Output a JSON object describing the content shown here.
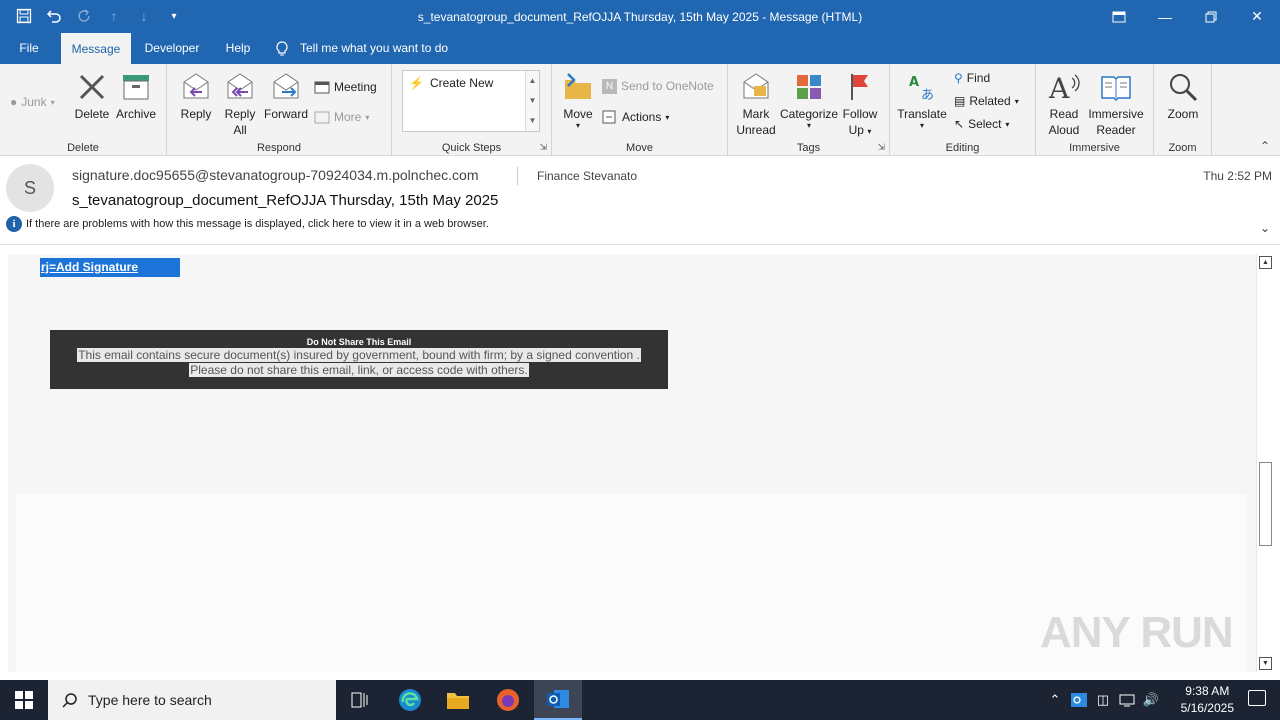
{
  "window": {
    "title": "s_tevanatogroup_document_RefOJJA Thursday, 15th May 2025  -  Message (HTML)"
  },
  "menu": {
    "tabs": [
      "File",
      "Message",
      "Developer",
      "Help"
    ],
    "tellme": "Tell me what you want to do"
  },
  "ribbon": {
    "junk": "Junk",
    "delete": "Delete",
    "archive": "Archive",
    "group_delete": "Delete",
    "reply": "Reply",
    "reply_all_1": "Reply",
    "reply_all_2": "All",
    "forward": "Forward",
    "meeting": "Meeting",
    "more": "More",
    "group_respond": "Respond",
    "create_new": "Create New",
    "group_quicksteps": "Quick Steps",
    "move": "Move",
    "send_onenote": "Send to OneNote",
    "actions": "Actions",
    "group_move": "Move",
    "mark_unread_1": "Mark",
    "mark_unread_2": "Unread",
    "categorize": "Categorize",
    "followup_1": "Follow",
    "followup_2": "Up",
    "group_tags": "Tags",
    "translate": "Translate",
    "find": "Find",
    "related": "Related",
    "select": "Select",
    "group_editing": "Editing",
    "read_aloud_1": "Read",
    "read_aloud_2": "Aloud",
    "immersive_1": "Immersive",
    "immersive_2": "Reader",
    "group_immersive": "Immersive",
    "zoom": "Zoom",
    "group_zoom": "Zoom"
  },
  "message": {
    "avatar_letter": "S",
    "sender": "signature.doc95655@stevanatogroup-70924034.m.polnchec.com",
    "to": "Finance Stevanato",
    "time": "Thu 2:52 PM",
    "subject": "s_tevanatogroup_document_RefOJJA Thursday, 15th May 2025",
    "info": "If there are problems with how this message is displayed, click here to view it in a web browser."
  },
  "body": {
    "signature_link": "rj=Add Signature",
    "notice_title": "Do Not Share This Email",
    "notice_line1": "This email contains secure document(s) insured by government, bound with firm; by a signed convention .",
    "notice_line2": "Please do not share this email, link, or access code with others."
  },
  "taskbar": {
    "search_placeholder": "Type here to search",
    "time": "9:38 AM",
    "date": "5/16/2025"
  },
  "watermark": "ANY RUN",
  "colors": {
    "accent": "#2166b0",
    "selection": "#1c74d9",
    "taskbar": "#1c2433"
  }
}
